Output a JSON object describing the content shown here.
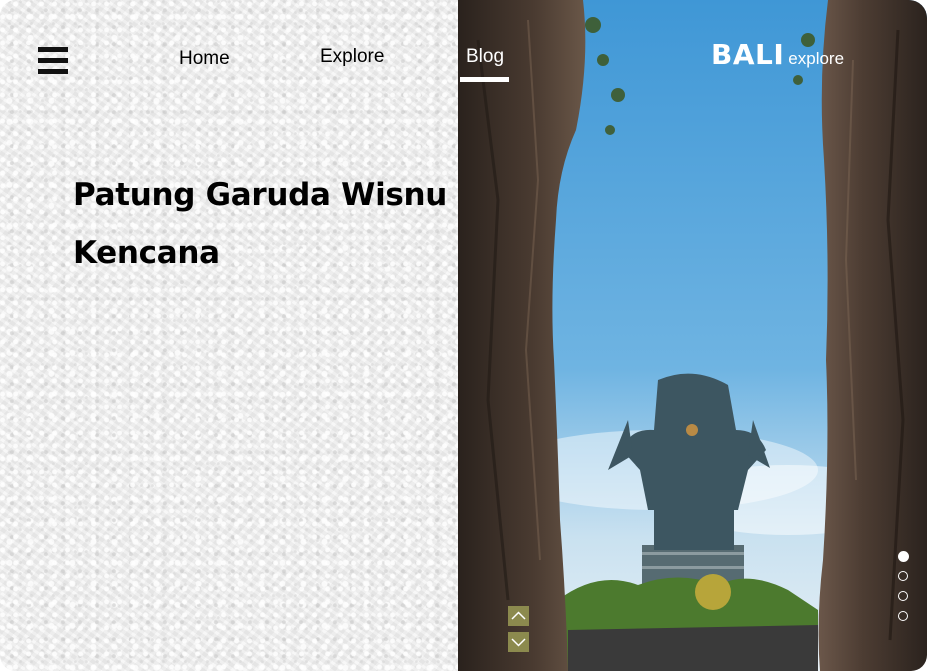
{
  "nav": {
    "home_label": "Home",
    "explore_label": "Explore",
    "blog_label": "Blog",
    "active": "Blog"
  },
  "menu_icon": "hamburger-menu-icon",
  "hero": {
    "title_line1": "Patung Garuda Wisnu",
    "title_line2": "Kencana"
  },
  "brand": {
    "main": "BALI",
    "sub": "explore"
  },
  "slider": {
    "up_icon": "chevron-up-icon",
    "down_icon": "chevron-down-icon",
    "current_slide": 1,
    "total_slides": 4
  },
  "colors": {
    "accent_button": "#8c8a4e",
    "sky": "#5aa7dc",
    "text": "#000000"
  }
}
